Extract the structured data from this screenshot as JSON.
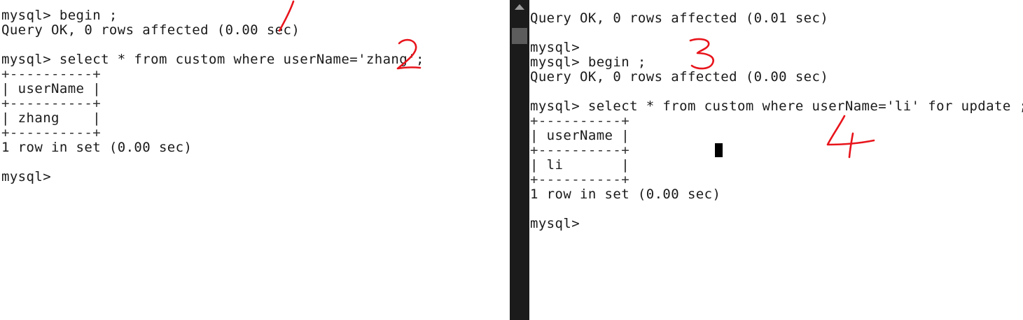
{
  "left_terminal": {
    "lines": [
      "mysql> begin ;",
      "Query OK, 0 rows affected (0.00 sec)",
      "mysql> select * from custom where userName='zhang';",
      "+----------+",
      "| userName |",
      "+----------+",
      "| zhang    |",
      "+----------+",
      "1 row in set (0.00 sec)",
      "mysql>"
    ]
  },
  "right_terminal": {
    "lines": [
      "Query OK, 0 rows affected (0.01 sec)",
      "mysql>",
      "mysql> begin ;",
      "Query OK, 0 rows affected (0.00 sec)",
      "mysql> select * from custom where userName='li' for update ;",
      "+----------+",
      "| userName |",
      "+----------+",
      "| li       |",
      "+----------+",
      "1 row in set (0.00 sec)",
      "mysql>"
    ]
  },
  "annotations": {
    "color": "#e8141b",
    "marks": [
      "1",
      "2",
      "3",
      "4"
    ]
  }
}
